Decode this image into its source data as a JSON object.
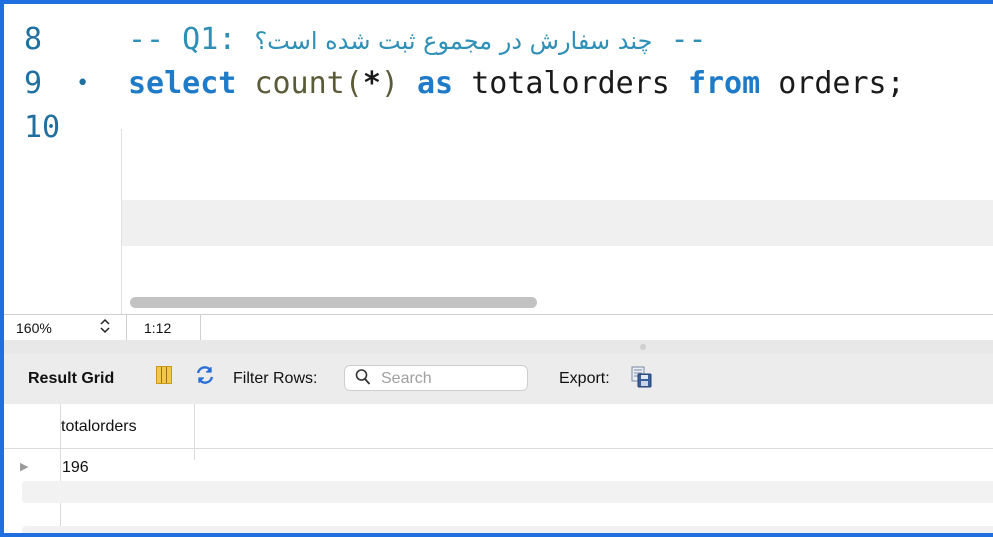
{
  "editor": {
    "lines": [
      {
        "number": "8",
        "marker": "",
        "comment_prefix": "-- Q1:",
        "comment_rtl": "چند سفارش در مجموع ثبت شده است؟",
        "comment_suffix": "--"
      },
      {
        "number": "9",
        "marker": "•",
        "tokens": {
          "select": "select",
          "count": "count",
          "paren_open": "(",
          "star": "*",
          "paren_close": ")",
          "as": "as",
          "alias": "totalorders",
          "from": "from",
          "table": "orders",
          "semicolon": ";"
        }
      },
      {
        "number": "10",
        "marker": ""
      }
    ]
  },
  "status_bar": {
    "zoom": "160%",
    "zoom_stepper_icon": "up-down-chevron-icon",
    "cursor_position": "1:12"
  },
  "result_toolbar": {
    "result_grid_label": "Result Grid",
    "columns_icon": "columns-icon",
    "refresh_icon": "refresh-icon",
    "filter_rows_label": "Filter Rows:",
    "search_placeholder": "Search",
    "search_value": "",
    "export_label": "Export:",
    "export_icon": "export-icon"
  },
  "result_grid": {
    "columns": [
      "totalorders"
    ],
    "rows": [
      [
        "196"
      ]
    ]
  },
  "colors": {
    "frame_border": "#1f6fe0",
    "keyword": "#1f7ac8",
    "comment": "#2e8fb7",
    "line_number": "#1f6fa0"
  }
}
